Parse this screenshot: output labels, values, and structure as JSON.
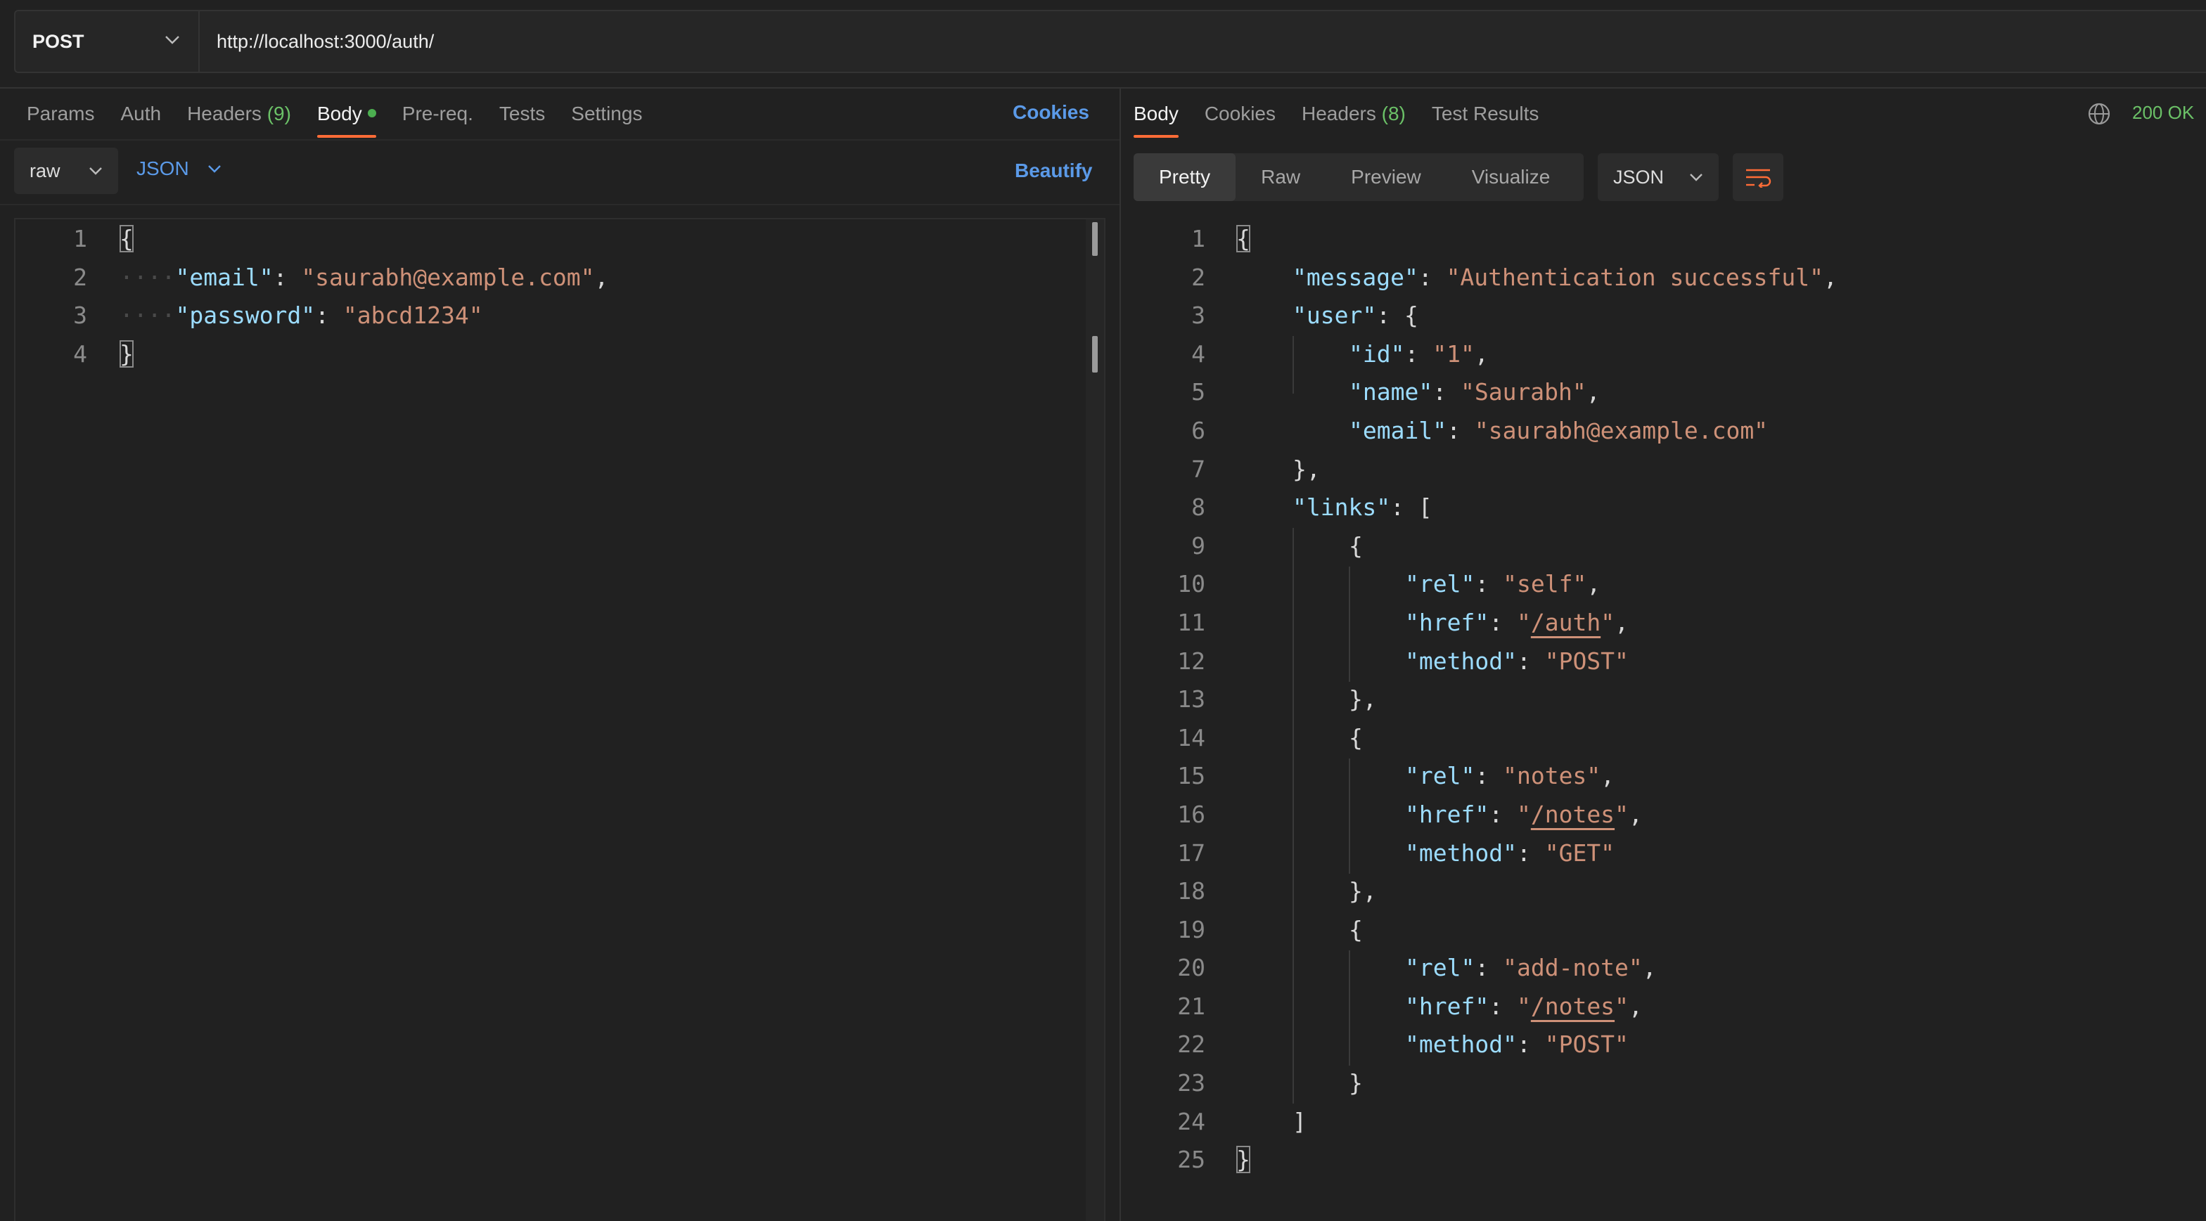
{
  "request": {
    "method": "POST",
    "url": "http://localhost:3000/auth/"
  },
  "request_tabs": [
    {
      "label": "Params"
    },
    {
      "label": "Auth"
    },
    {
      "label": "Headers",
      "count": "(9)"
    },
    {
      "label": "Body"
    },
    {
      "label": "Pre-req."
    },
    {
      "label": "Tests"
    },
    {
      "label": "Settings"
    }
  ],
  "request_links": {
    "cookies": "Cookies",
    "beautify": "Beautify"
  },
  "body_options": {
    "mode": "raw",
    "language": "JSON"
  },
  "request_body_line_numbers": [
    "1",
    "2",
    "3",
    "4"
  ],
  "request_body_lines": [
    "{",
    "\"email\": \"saurabh@example.com\",",
    "\"password\": \"abcd1234\"",
    "}"
  ],
  "response_tabs": [
    {
      "label": "Body"
    },
    {
      "label": "Cookies"
    },
    {
      "label": "Headers",
      "count": "(8)"
    },
    {
      "label": "Test Results"
    }
  ],
  "response_status": "200 OK",
  "response_views": [
    "Pretty",
    "Raw",
    "Preview",
    "Visualize"
  ],
  "response_format": "JSON",
  "response_line_numbers": [
    "1",
    "2",
    "3",
    "4",
    "5",
    "6",
    "7",
    "8",
    "9",
    "10",
    "11",
    "12",
    "13",
    "14",
    "15",
    "16",
    "17",
    "18",
    "19",
    "20",
    "21",
    "22",
    "23",
    "24",
    "25"
  ],
  "response_body_lines": [
    "{",
    "\"message\": \"Authentication successful\",",
    "\"user\": {",
    "\"id\": \"1\",",
    "\"name\": \"Saurabh\",",
    "\"email\": \"saurabh@example.com\"",
    "},",
    "\"links\": [",
    "{",
    "\"rel\": \"self\",",
    "\"href\": \"/auth\",",
    "\"method\": \"POST\"",
    "},",
    "{",
    "\"rel\": \"notes\",",
    "\"href\": \"/notes\",",
    "\"method\": \"GET\"",
    "},",
    "{",
    "\"rel\": \"add-note\",",
    "\"href\": \"/notes\",",
    "\"method\": \"POST\"",
    "}",
    "]",
    "}"
  ],
  "colors": {
    "accent": "#ff6c37",
    "status_ok": "#6bc167",
    "link": "#5b9ae8",
    "key": "#9cdcfe",
    "string": "#ce9178"
  },
  "icons": {
    "method_dropdown": "chevron-down-icon",
    "network": "globe-icon",
    "wrap": "wrap-lines-icon"
  }
}
